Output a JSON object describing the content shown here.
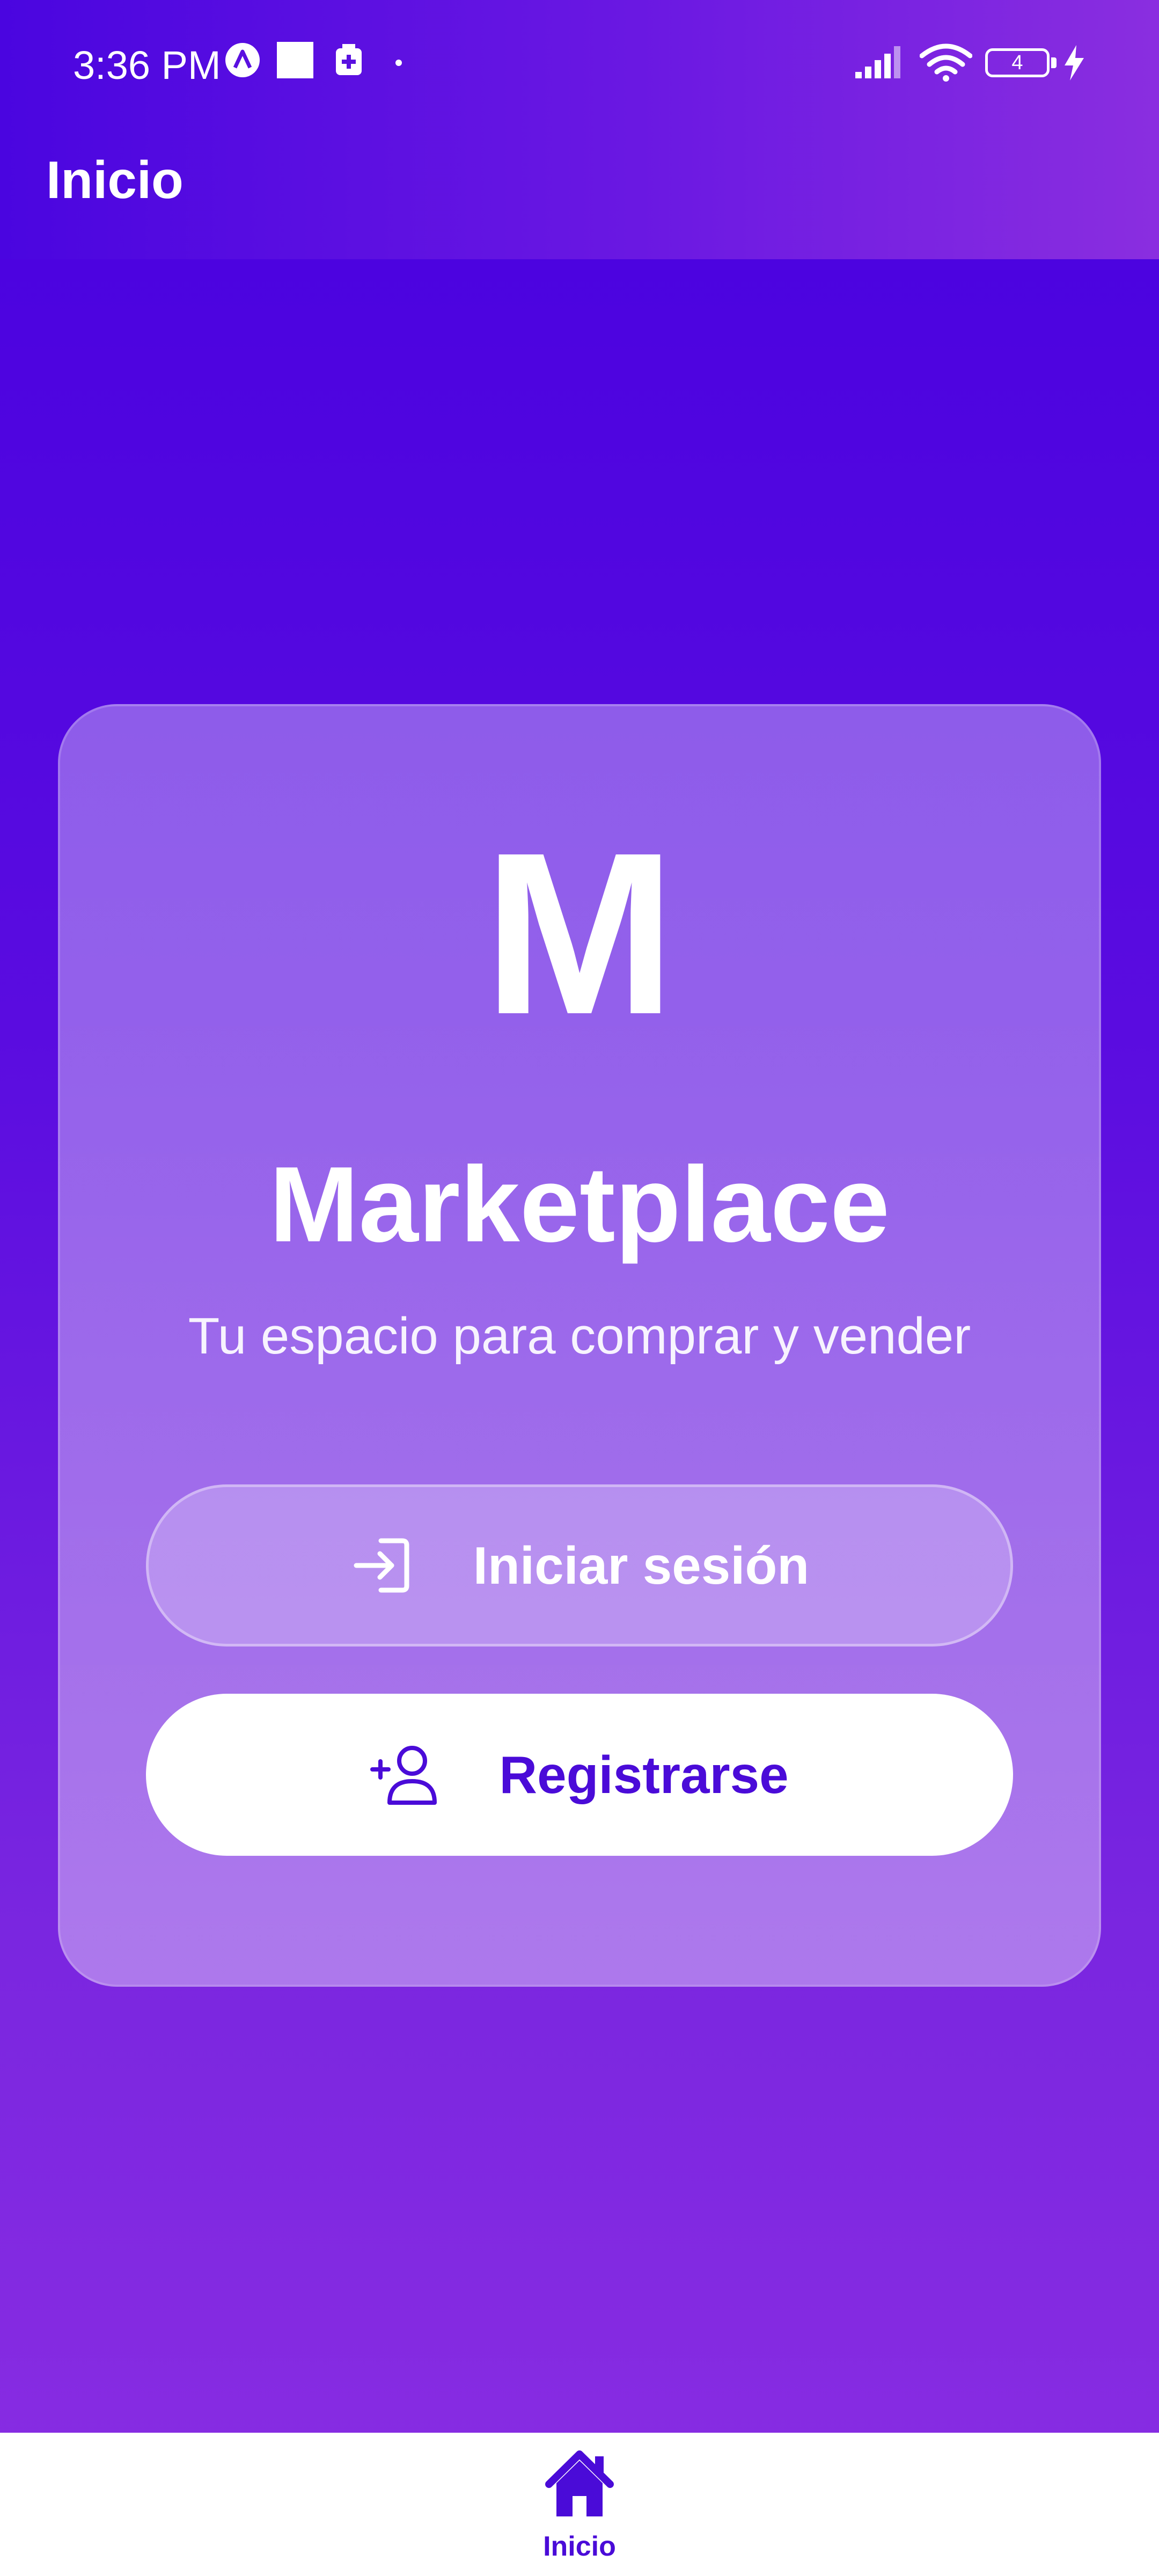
{
  "status_bar": {
    "time": "3:36 PM",
    "battery_level": "4"
  },
  "app_bar": {
    "title": "Inicio"
  },
  "hero": {
    "logo_letter": "M",
    "app_name": "Marketplace",
    "tagline": "Tu espacio para comprar y vender"
  },
  "actions": {
    "login_label": "Iniciar sesión",
    "login_icon": "login-arrow-icon",
    "register_label": "Registrarse",
    "register_icon": "add-user-icon"
  },
  "bottom_nav": {
    "items": [
      {
        "label": "Inicio",
        "icon": "home-icon",
        "active": true
      }
    ]
  },
  "colors": {
    "primary": "#4a0bd8",
    "background_top": "#4700e0",
    "background_bottom": "#8a2de2",
    "on_primary": "#ffffff"
  }
}
